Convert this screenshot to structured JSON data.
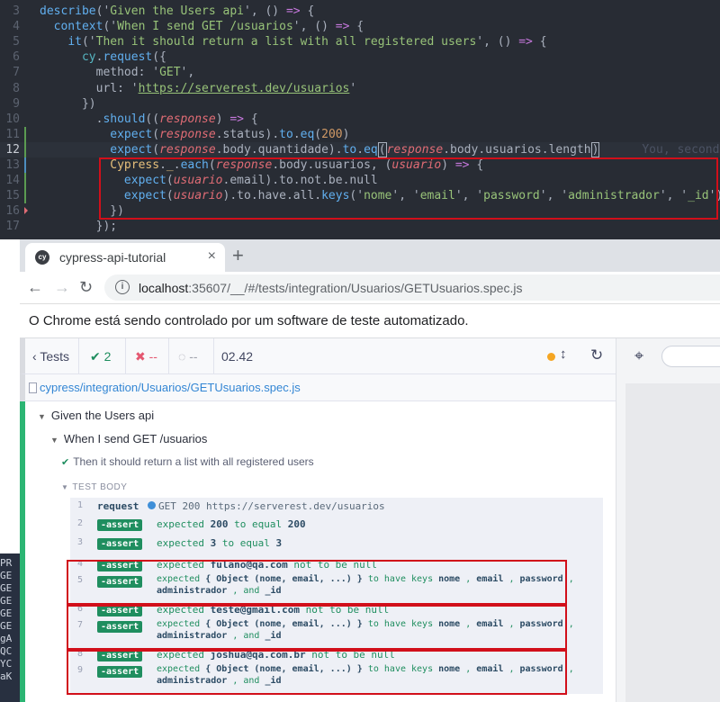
{
  "editor": {
    "lines": [
      {
        "n": "3",
        "marker": "",
        "current": false,
        "segs": [
          [
            "t-fn",
            "describe"
          ],
          [
            "",
            "('"
          ],
          [
            "t-str",
            "Given the Users api"
          ],
          [
            "",
            "', () "
          ],
          [
            "t-kw",
            "=>"
          ],
          [
            "",
            " {"
          ]
        ]
      },
      {
        "n": "4",
        "marker": "",
        "current": false,
        "segs": [
          [
            "",
            "  "
          ],
          [
            "t-fn",
            "context"
          ],
          [
            "",
            "('"
          ],
          [
            "t-str",
            "When I send GET /usuarios"
          ],
          [
            "",
            "', () "
          ],
          [
            "t-kw",
            "=>"
          ],
          [
            "",
            " {"
          ]
        ]
      },
      {
        "n": "5",
        "marker": "",
        "current": false,
        "segs": [
          [
            "",
            "    "
          ],
          [
            "t-fn",
            "it"
          ],
          [
            "",
            "('"
          ],
          [
            "t-str",
            "Then it should return a list with all registered users"
          ],
          [
            "",
            "', () "
          ],
          [
            "t-kw",
            "=>"
          ],
          [
            "",
            " {"
          ]
        ]
      },
      {
        "n": "6",
        "marker": "",
        "current": false,
        "segs": [
          [
            "",
            "      "
          ],
          [
            "t-op",
            "cy"
          ],
          [
            "",
            "."
          ],
          [
            "t-fn",
            "request"
          ],
          [
            "",
            "({"
          ]
        ]
      },
      {
        "n": "7",
        "marker": "",
        "current": false,
        "segs": [
          [
            "",
            "        method: '"
          ],
          [
            "t-str",
            "GET"
          ],
          [
            "",
            "',"
          ]
        ]
      },
      {
        "n": "8",
        "marker": "",
        "current": false,
        "segs": [
          [
            "",
            "        url: '"
          ],
          [
            "t-url",
            "https://serverest.dev/usuarios"
          ],
          [
            "",
            "'"
          ]
        ]
      },
      {
        "n": "9",
        "marker": "",
        "current": false,
        "segs": [
          [
            "",
            "      })"
          ]
        ]
      },
      {
        "n": "10",
        "marker": "",
        "current": false,
        "segs": [
          [
            "",
            "        ."
          ],
          [
            "t-fn",
            "should"
          ],
          [
            "",
            "(("
          ],
          [
            "t-par",
            "response"
          ],
          [
            "",
            ") "
          ],
          [
            "t-kw",
            "=>"
          ],
          [
            "",
            " {"
          ]
        ]
      },
      {
        "n": "11",
        "marker": "a",
        "current": false,
        "segs": [
          [
            "",
            "          "
          ],
          [
            "t-fn",
            "expect"
          ],
          [
            "",
            "("
          ],
          [
            "t-par",
            "response"
          ],
          [
            "",
            ".status)."
          ],
          [
            "t-fn",
            "to"
          ],
          [
            "",
            "."
          ],
          [
            "t-fn",
            "eq"
          ],
          [
            "",
            "("
          ],
          [
            "t-num",
            "200"
          ],
          [
            "",
            ")"
          ]
        ]
      },
      {
        "n": "12",
        "marker": "a",
        "current": true,
        "segs": [
          [
            "",
            "          "
          ],
          [
            "t-fn",
            "expect"
          ],
          [
            "",
            "("
          ],
          [
            "t-par",
            "response"
          ],
          [
            "",
            ".body.quantidade)."
          ],
          [
            "t-fn",
            "to"
          ],
          [
            "",
            "."
          ],
          [
            "t-fn",
            "eq"
          ],
          [
            "bm",
            "("
          ],
          [
            "t-par",
            "response"
          ],
          [
            "",
            ".body.usuarios.length"
          ],
          [
            "bm",
            ")"
          ],
          [
            "t-blame",
            "      You, seconds a"
          ]
        ]
      },
      {
        "n": "13",
        "marker": "m",
        "current": false,
        "segs": [
          [
            "",
            "          "
          ],
          [
            "t-prop",
            "Cypress"
          ],
          [
            "",
            "."
          ],
          [
            "t-prop",
            "_"
          ],
          [
            "",
            "."
          ],
          [
            "t-fn",
            "each"
          ],
          [
            "",
            "("
          ],
          [
            "t-par",
            "response"
          ],
          [
            "",
            ".body.usuarios, ("
          ],
          [
            "t-par",
            "usuario"
          ],
          [
            "",
            ") "
          ],
          [
            "t-kw",
            "=>"
          ],
          [
            "",
            " {"
          ]
        ]
      },
      {
        "n": "14",
        "marker": "a",
        "current": false,
        "segs": [
          [
            "",
            "            "
          ],
          [
            "t-fn",
            "expect"
          ],
          [
            "",
            "("
          ],
          [
            "t-par",
            "usuario"
          ],
          [
            "",
            ".email).to.not.be.null"
          ]
        ]
      },
      {
        "n": "15",
        "marker": "a",
        "current": false,
        "segs": [
          [
            "",
            "            "
          ],
          [
            "t-fn",
            "expect"
          ],
          [
            "",
            "("
          ],
          [
            "t-par",
            "usuario"
          ],
          [
            "",
            ").to.have.all."
          ],
          [
            "t-fn",
            "keys"
          ],
          [
            "",
            "('"
          ],
          [
            "t-str",
            "nome"
          ],
          [
            "",
            "', '"
          ],
          [
            "t-str",
            "email"
          ],
          [
            "",
            "', '"
          ],
          [
            "t-str",
            "password"
          ],
          [
            "",
            "', '"
          ],
          [
            "t-str",
            "administrador"
          ],
          [
            "",
            "', '"
          ],
          [
            "t-str",
            "_id"
          ],
          [
            "",
            "')"
          ]
        ]
      },
      {
        "n": "16",
        "marker": "d",
        "current": false,
        "segs": [
          [
            "",
            "          })"
          ]
        ]
      },
      {
        "n": "17",
        "marker": "",
        "current": false,
        "segs": [
          [
            "",
            "        });"
          ]
        ]
      }
    ]
  },
  "browser": {
    "tab_title": "cypress-api-tutorial",
    "tab_favicon": "cy",
    "tab_close": "×",
    "new_tab": "+",
    "url_host": "localhost",
    "url_rest": ":35607/__/#/tests/integration/Usuarios/GETUsuarios.spec.js",
    "infobar_text": "O Chrome está sendo controlado por um software de teste automatizado."
  },
  "runner": {
    "tests_label": "Tests",
    "passed": "2",
    "failed": "--",
    "pending": "--",
    "duration": "02.42",
    "spec_path": "cypress/integration/Usuarios/GETUsuarios.spec.js",
    "suite": "Given the Users api",
    "context": "When I send GET /usuarios",
    "test": "Then it should return a list with all registered users",
    "test_body_label": "TEST BODY",
    "colors": {
      "pass": "#1f8e5f",
      "fail": "#e45770",
      "highlight_box": "#d10f1a"
    },
    "commands": [
      {
        "n": "1",
        "type": "request",
        "label": "request",
        "method": "GET",
        "status": "200",
        "url": "https://serverest.dev/usuarios"
      },
      {
        "n": "2",
        "type": "assert",
        "label": "-assert",
        "pre": "expected",
        "v1": "200",
        "mid": "to equal",
        "v2": "200"
      },
      {
        "n": "3",
        "type": "assert",
        "label": "-assert",
        "pre": "expected",
        "v1": "3",
        "mid": "to equal",
        "v2": "3"
      },
      {
        "n": "4",
        "type": "assert",
        "label": "-assert",
        "pre": "expected",
        "v1": "fulano@qa.com",
        "mid": "not to be null"
      },
      {
        "n": "5",
        "type": "keys",
        "label": "-assert",
        "pre": "expected",
        "obj": "{ Object (nome, email, ...) }",
        "mid": "to have keys",
        "k1": "nome",
        "k2": "email",
        "k3": "password",
        "k4": "administrador",
        "and": "and",
        "k5": "_id"
      },
      {
        "n": "6",
        "type": "assert",
        "label": "-assert",
        "pre": "expected",
        "v1": "teste@gmail.com",
        "mid": "not to be null"
      },
      {
        "n": "7",
        "type": "keys",
        "label": "-assert",
        "pre": "expected",
        "obj": "{ Object (nome, email, ...) }",
        "mid": "to have keys",
        "k1": "nome",
        "k2": "email",
        "k3": "password",
        "k4": "administrador",
        "and": "and",
        "k5": "_id"
      },
      {
        "n": "8",
        "type": "assert",
        "label": "-assert",
        "pre": "expected",
        "v1": "joshua@qa.com.br",
        "mid": "not to be null"
      },
      {
        "n": "9",
        "type": "keys",
        "label": "-assert",
        "pre": "expected",
        "obj": "{ Object (nome, email, ...) }",
        "mid": "to have keys",
        "k1": "nome",
        "k2": "email",
        "k3": "password",
        "k4": "administrador",
        "and": "and",
        "k5": "_id"
      }
    ]
  },
  "terminal": {
    "lines": [
      "PR",
      "GE",
      "GE",
      "GE",
      "GE",
      "GE",
      "gA",
      "QC",
      "YC",
      "aK"
    ]
  }
}
